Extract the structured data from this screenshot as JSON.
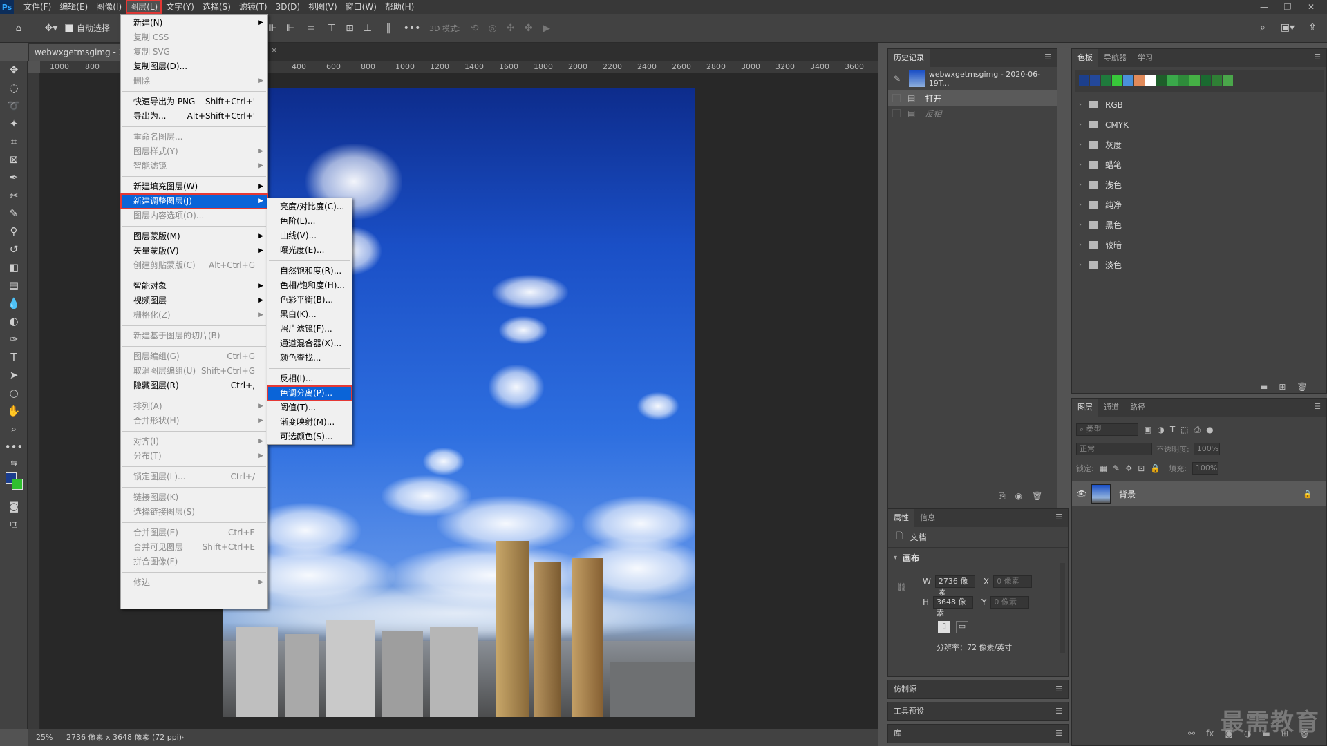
{
  "app": {
    "logo": "Ps"
  },
  "menubar": [
    "文件(F)",
    "编辑(E)",
    "图像(I)",
    "图层(L)",
    "文字(Y)",
    "选择(S)",
    "滤镜(T)",
    "3D(D)",
    "视图(V)",
    "窗口(W)",
    "帮助(H)"
  ],
  "options": {
    "auto_select": "自动选择",
    "mode_3d": "3D 模式:"
  },
  "document": {
    "tab_title": "webwxgetmsgimg - 20..."
  },
  "rulers": {
    "h": [
      "1000",
      "800",
      "400",
      "600",
      "800",
      "1000",
      "1200",
      "1400",
      "1600",
      "1800",
      "2000",
      "2200",
      "2400",
      "2600",
      "2800",
      "3000",
      "3200",
      "3400",
      "3600"
    ]
  },
  "status": {
    "zoom": "25%",
    "info": "2736 像素 x 3648 像素 (72 ppi)"
  },
  "layer_menu": {
    "items": [
      {
        "label": "新建(N)",
        "shortcut": "",
        "arrow": true,
        "disabled": false
      },
      {
        "label": "复制 CSS",
        "shortcut": "",
        "arrow": false,
        "disabled": true
      },
      {
        "label": "复制 SVG",
        "shortcut": "",
        "arrow": false,
        "disabled": true
      },
      {
        "label": "复制图层(D)...",
        "shortcut": "",
        "arrow": false,
        "disabled": false
      },
      {
        "label": "删除",
        "shortcut": "",
        "arrow": true,
        "disabled": true
      },
      {
        "sep": true
      },
      {
        "label": "快速导出为 PNG",
        "shortcut": "Shift+Ctrl+'",
        "arrow": false,
        "disabled": false
      },
      {
        "label": "导出为...",
        "shortcut": "Alt+Shift+Ctrl+'",
        "arrow": false,
        "disabled": false
      },
      {
        "sep": true
      },
      {
        "label": "重命名图层...",
        "shortcut": "",
        "arrow": false,
        "disabled": true
      },
      {
        "label": "图层样式(Y)",
        "shortcut": "",
        "arrow": true,
        "disabled": true
      },
      {
        "label": "智能滤镜",
        "shortcut": "",
        "arrow": true,
        "disabled": true
      },
      {
        "sep": true
      },
      {
        "label": "新建填充图层(W)",
        "shortcut": "",
        "arrow": true,
        "disabled": false
      },
      {
        "label": "新建调整图层(J)",
        "shortcut": "",
        "arrow": true,
        "disabled": false,
        "highlight": true
      },
      {
        "label": "图层内容选项(O)...",
        "shortcut": "",
        "arrow": false,
        "disabled": true
      },
      {
        "sep": true
      },
      {
        "label": "图层蒙版(M)",
        "shortcut": "",
        "arrow": true,
        "disabled": false
      },
      {
        "label": "矢量蒙版(V)",
        "shortcut": "",
        "arrow": true,
        "disabled": false
      },
      {
        "label": "创建剪贴蒙版(C)",
        "shortcut": "Alt+Ctrl+G",
        "arrow": false,
        "disabled": true
      },
      {
        "sep": true
      },
      {
        "label": "智能对象",
        "shortcut": "",
        "arrow": true,
        "disabled": false
      },
      {
        "label": "视频图层",
        "shortcut": "",
        "arrow": true,
        "disabled": false
      },
      {
        "label": "栅格化(Z)",
        "shortcut": "",
        "arrow": true,
        "disabled": true
      },
      {
        "sep": true
      },
      {
        "label": "新建基于图层的切片(B)",
        "shortcut": "",
        "arrow": false,
        "disabled": true
      },
      {
        "sep": true
      },
      {
        "label": "图层编组(G)",
        "shortcut": "Ctrl+G",
        "arrow": false,
        "disabled": true
      },
      {
        "label": "取消图层编组(U)",
        "shortcut": "Shift+Ctrl+G",
        "arrow": false,
        "disabled": true
      },
      {
        "label": "隐藏图层(R)",
        "shortcut": "Ctrl+,",
        "arrow": false,
        "disabled": false
      },
      {
        "sep": true
      },
      {
        "label": "排列(A)",
        "shortcut": "",
        "arrow": true,
        "disabled": true
      },
      {
        "label": "合并形状(H)",
        "shortcut": "",
        "arrow": true,
        "disabled": true
      },
      {
        "sep": true
      },
      {
        "label": "对齐(I)",
        "shortcut": "",
        "arrow": true,
        "disabled": true
      },
      {
        "label": "分布(T)",
        "shortcut": "",
        "arrow": true,
        "disabled": true
      },
      {
        "sep": true
      },
      {
        "label": "锁定图层(L)...",
        "shortcut": "Ctrl+/",
        "arrow": false,
        "disabled": true
      },
      {
        "sep": true
      },
      {
        "label": "链接图层(K)",
        "shortcut": "",
        "arrow": false,
        "disabled": true
      },
      {
        "label": "选择链接图层(S)",
        "shortcut": "",
        "arrow": false,
        "disabled": true
      },
      {
        "sep": true
      },
      {
        "label": "合并图层(E)",
        "shortcut": "Ctrl+E",
        "arrow": false,
        "disabled": true
      },
      {
        "label": "合并可见图层",
        "shortcut": "Shift+Ctrl+E",
        "arrow": false,
        "disabled": true
      },
      {
        "label": "拼合图像(F)",
        "shortcut": "",
        "arrow": false,
        "disabled": true
      },
      {
        "sep": true
      },
      {
        "label": "修边",
        "shortcut": "",
        "arrow": true,
        "disabled": true
      }
    ]
  },
  "adjust_submenu": {
    "items": [
      {
        "label": "亮度/对比度(C)..."
      },
      {
        "label": "色阶(L)..."
      },
      {
        "label": "曲线(V)..."
      },
      {
        "label": "曝光度(E)..."
      },
      {
        "sep": true
      },
      {
        "label": "自然饱和度(R)..."
      },
      {
        "label": "色相/饱和度(H)..."
      },
      {
        "label": "色彩平衡(B)..."
      },
      {
        "label": "黑白(K)..."
      },
      {
        "label": "照片滤镜(F)..."
      },
      {
        "label": "通道混合器(X)..."
      },
      {
        "label": "颜色查找..."
      },
      {
        "sep": true
      },
      {
        "label": "反相(I)..."
      },
      {
        "label": "色调分离(P)...",
        "highlight": true
      },
      {
        "label": "阈值(T)..."
      },
      {
        "label": "渐变映射(M)..."
      },
      {
        "label": "可选颜色(S)..."
      }
    ]
  },
  "history": {
    "tab": "历史记录",
    "snapshot": "webwxgetmsgimg - 2020-06-19T...",
    "states": [
      "打开",
      "反相"
    ]
  },
  "properties": {
    "tabs": [
      "属性",
      "信息"
    ],
    "doc_label": "文档",
    "canvas_label": "画布",
    "w_label": "W",
    "w_value": "2736 像素",
    "h_label": "H",
    "h_value": "3648 像素",
    "x_label": "X",
    "x_placeholder": "0 像素",
    "y_label": "Y",
    "y_placeholder": "0 像素",
    "resolution": "分辨率：72 像素/英寸"
  },
  "collapsed_panels": [
    "仿制源",
    "工具预设",
    "库"
  ],
  "swatches": {
    "tabs": [
      "色板",
      "导航器",
      "学习"
    ],
    "colors": [
      "#1c3f8c",
      "#23489a",
      "#1f7a3c",
      "#38c73a",
      "#4a90d9",
      "#e08a5a",
      "#ffffff",
      "#1e5e2a",
      "#3aa84a",
      "#2e8b3a",
      "#45b045",
      "#1a6a30",
      "#2f7f35",
      "#4aa64a"
    ],
    "groups": [
      "RGB",
      "CMYK",
      "灰度",
      "蜡笔",
      "浅色",
      "纯净",
      "黑色",
      "较暗",
      "淡色"
    ]
  },
  "layers": {
    "tabs": [
      "图层",
      "通道",
      "路径"
    ],
    "filter_placeholder": "类型",
    "blend_mode": "正常",
    "opacity_label": "不透明度:",
    "opacity_value": "100%",
    "lock_label": "锁定:",
    "fill_label": "填充:",
    "fill_value": "100%",
    "layer_name": "背景"
  },
  "watermark": "最需教育"
}
